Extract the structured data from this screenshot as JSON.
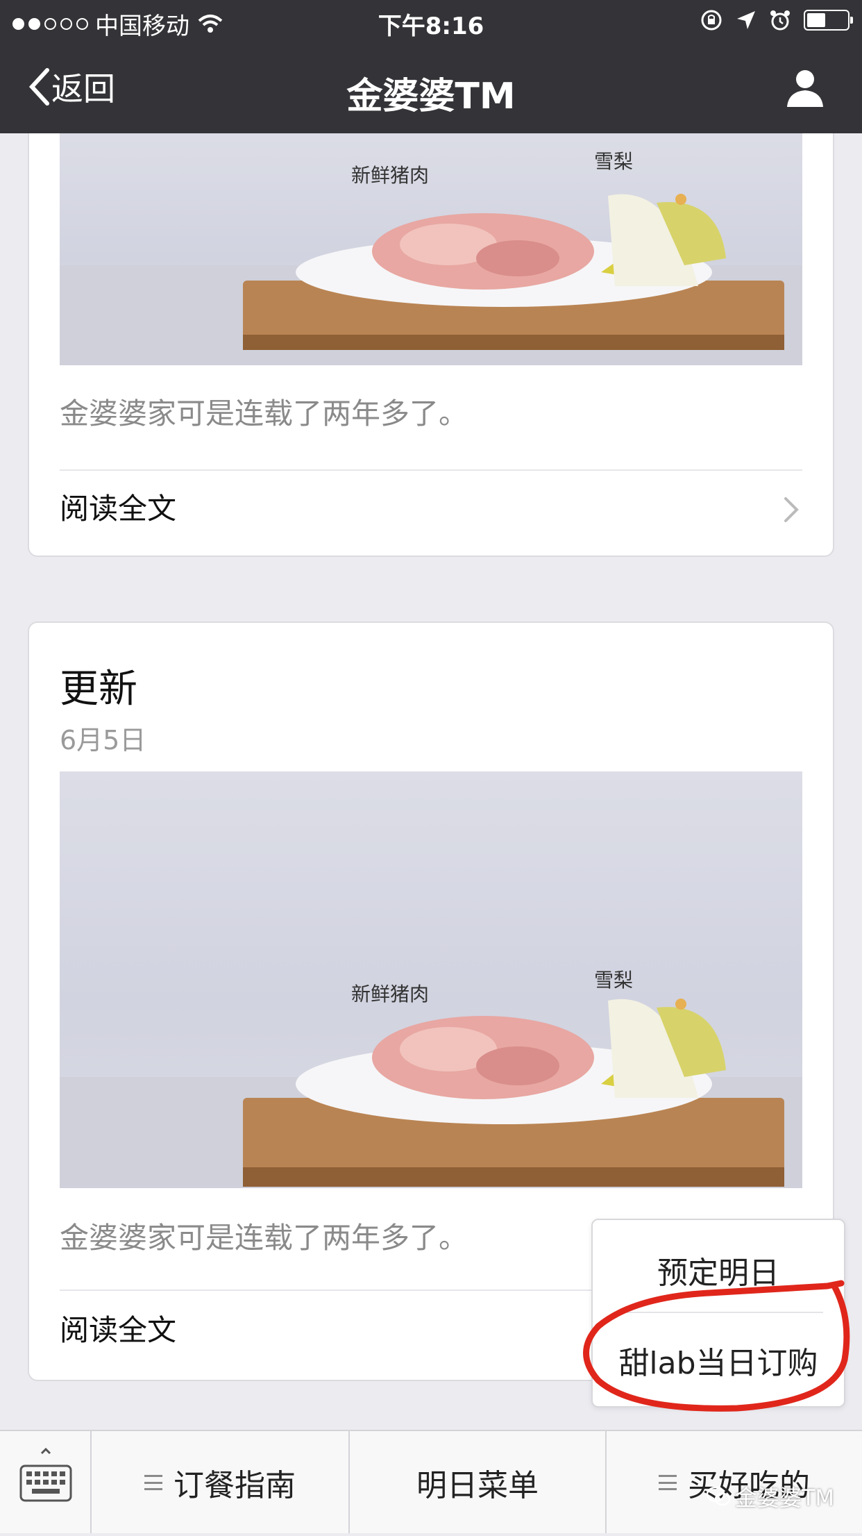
{
  "status_bar": {
    "carrier": "中国移动",
    "time": "下午8:16"
  },
  "nav": {
    "back_label": "返回",
    "title": "金婆婆TM"
  },
  "cards": [
    {
      "photo_labels": {
        "pork": "新鲜猪肉",
        "pear": "雪梨"
      },
      "description": "金婆婆家可是连载了两年多了。",
      "read_more": "阅读全文"
    },
    {
      "title": "更新",
      "date": "6月5日",
      "photo_labels": {
        "pork": "新鲜猪肉",
        "pear": "雪梨"
      },
      "description": "金婆婆家可是连载了两年多了。",
      "read_more": "阅读全文"
    }
  ],
  "popup_menu": {
    "items": [
      "预定明日",
      "甜lab当日订购"
    ],
    "annotation_color": "#e0261b"
  },
  "tab_bar": {
    "buttons": [
      "订餐指南",
      "明日菜单",
      "买好吃的"
    ]
  },
  "watermark": "金婆婆TM",
  "colors": {
    "nav_bg": "#343438",
    "page_bg": "#ebebf0"
  }
}
